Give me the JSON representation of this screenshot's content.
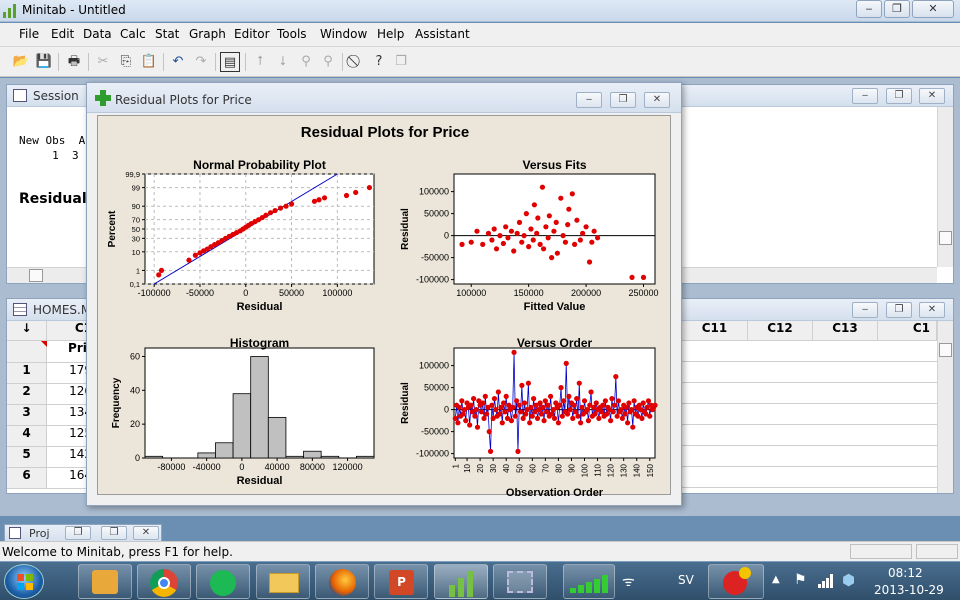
{
  "app": {
    "title": "Minitab - Untitled",
    "window_controls": {
      "minimize": "‒",
      "restore": "❐",
      "close": "✕"
    }
  },
  "menu": [
    "File",
    "Edit",
    "Data",
    "Calc",
    "Stat",
    "Graph",
    "Editor",
    "Tools",
    "Window",
    "Help",
    "Assistant"
  ],
  "session": {
    "title": "Session",
    "line1": "New Obs  A",
    "line2": "     1  3",
    "heading": "Residual P"
  },
  "worksheet": {
    "title": "HOMES.M",
    "corner": "↓",
    "col_c1": "C1",
    "col_c1_name": "Pric",
    "right_cols": [
      "C11",
      "C12",
      "C13",
      "C1"
    ],
    "rows": [
      {
        "n": "1",
        "v": "179"
      },
      {
        "n": "2",
        "v": "126"
      },
      {
        "n": "3",
        "v": "134"
      },
      {
        "n": "4",
        "v": "125"
      },
      {
        "n": "5",
        "v": "142"
      },
      {
        "n": "6",
        "v": "164"
      }
    ]
  },
  "graph_window": {
    "title": "Residual Plots for Price",
    "main_title": "Residual Plots for Price"
  },
  "chart_data": [
    {
      "type": "scatter",
      "title": "Normal Probability Plot",
      "xlabel": "Residual",
      "ylabel": "Percent",
      "xticks": [
        "-100000",
        "-50000",
        "0",
        "50000",
        "100000"
      ],
      "yticks": [
        "0,1",
        "1",
        "10",
        "30",
        "50",
        "70",
        "90",
        "99",
        "99,9"
      ],
      "x_ticks_values": [
        -100000,
        -50000,
        0,
        50000,
        100000
      ],
      "y_ticks_values": [
        0.1,
        1,
        10,
        30,
        50,
        70,
        90,
        99,
        99.9
      ],
      "xlim": [
        -110000,
        140000
      ],
      "ylim": [
        0.1,
        99.9
      ],
      "grid": true,
      "fit_line": [
        [
          -100000,
          0.05
        ],
        [
          100000,
          99.95
        ]
      ],
      "points": [
        [
          -95000,
          0.5
        ],
        [
          -92000,
          1
        ],
        [
          -62000,
          4
        ],
        [
          -55000,
          7
        ],
        [
          -50000,
          9
        ],
        [
          -46000,
          11
        ],
        [
          -42000,
          13
        ],
        [
          -38000,
          16
        ],
        [
          -34000,
          19
        ],
        [
          -30000,
          22
        ],
        [
          -26000,
          26
        ],
        [
          -22000,
          30
        ],
        [
          -18000,
          34
        ],
        [
          -14000,
          38
        ],
        [
          -10000,
          42
        ],
        [
          -6000,
          46
        ],
        [
          -3000,
          50
        ],
        [
          0,
          54
        ],
        [
          3000,
          58
        ],
        [
          6000,
          62
        ],
        [
          10000,
          66
        ],
        [
          14000,
          70
        ],
        [
          18000,
          74
        ],
        [
          22000,
          78
        ],
        [
          27000,
          82
        ],
        [
          32000,
          85
        ],
        [
          38000,
          88
        ],
        [
          44000,
          90
        ],
        [
          50000,
          92
        ],
        [
          75000,
          94
        ],
        [
          80000,
          95
        ],
        [
          86000,
          96
        ],
        [
          110000,
          97
        ],
        [
          120000,
          98
        ],
        [
          135000,
          99
        ]
      ]
    },
    {
      "type": "scatter",
      "title": "Versus Fits",
      "xlabel": "Fitted Value",
      "ylabel": "Residual",
      "xticks": [
        "100000",
        "150000",
        "200000",
        "250000"
      ],
      "yticks": [
        "-100000",
        "-50000",
        "0",
        "50000",
        "100000"
      ],
      "x_ticks_values": [
        100000,
        150000,
        200000,
        250000
      ],
      "y_ticks_values": [
        -100000,
        -50000,
        0,
        50000,
        100000
      ],
      "xlim": [
        85000,
        260000
      ],
      "ylim": [
        -110000,
        140000
      ],
      "hline": 0,
      "points": [
        [
          92000,
          -20000
        ],
        [
          100000,
          -15000
        ],
        [
          105000,
          10000
        ],
        [
          110000,
          -20000
        ],
        [
          115000,
          5000
        ],
        [
          118000,
          -10000
        ],
        [
          120000,
          15000
        ],
        [
          122000,
          -30000
        ],
        [
          125000,
          0
        ],
        [
          128000,
          -18000
        ],
        [
          130000,
          20000
        ],
        [
          132000,
          -5000
        ],
        [
          135000,
          10000
        ],
        [
          137000,
          -35000
        ],
        [
          140000,
          5000
        ],
        [
          142000,
          30000
        ],
        [
          144000,
          -15000
        ],
        [
          146000,
          0
        ],
        [
          148000,
          50000
        ],
        [
          150000,
          -25000
        ],
        [
          152000,
          15000
        ],
        [
          154000,
          -10000
        ],
        [
          155000,
          70000
        ],
        [
          157000,
          5000
        ],
        [
          158000,
          40000
        ],
        [
          160000,
          -20000
        ],
        [
          162000,
          110000
        ],
        [
          163000,
          -30000
        ],
        [
          165000,
          20000
        ],
        [
          167000,
          -5000
        ],
        [
          168000,
          45000
        ],
        [
          170000,
          -50000
        ],
        [
          172000,
          10000
        ],
        [
          174000,
          30000
        ],
        [
          175000,
          -40000
        ],
        [
          178000,
          85000
        ],
        [
          180000,
          0
        ],
        [
          182000,
          -15000
        ],
        [
          184000,
          25000
        ],
        [
          185000,
          60000
        ],
        [
          188000,
          95000
        ],
        [
          190000,
          -20000
        ],
        [
          192000,
          35000
        ],
        [
          195000,
          -10000
        ],
        [
          197000,
          5000
        ],
        [
          200000,
          20000
        ],
        [
          203000,
          -60000
        ],
        [
          205000,
          -15000
        ],
        [
          207000,
          10000
        ],
        [
          210000,
          -5000
        ],
        [
          240000,
          -95000
        ],
        [
          250000,
          -95000
        ]
      ]
    },
    {
      "type": "bar",
      "title": "Histogram",
      "xlabel": "Residual",
      "ylabel": "Frequency",
      "xticks": [
        "-80000",
        "-40000",
        "0",
        "40000",
        "80000",
        "120000"
      ],
      "yticks": [
        "0",
        "20",
        "40",
        "60"
      ],
      "x_ticks_values": [
        -80000,
        -40000,
        0,
        40000,
        80000,
        120000
      ],
      "y_ticks_values": [
        0,
        20,
        40,
        60
      ],
      "xlim": [
        -110000,
        150000
      ],
      "ylim": [
        0,
        65
      ],
      "bin_width": 20000,
      "bins": [
        -100000,
        -80000,
        -60000,
        -40000,
        -20000,
        0,
        20000,
        40000,
        60000,
        80000,
        100000,
        120000,
        140000
      ],
      "values": [
        1,
        0,
        0,
        3,
        9,
        38,
        60,
        24,
        1,
        4,
        1,
        0,
        1
      ]
    },
    {
      "type": "line",
      "title": "Versus Order",
      "xlabel": "Observation Order",
      "ylabel": "Residual",
      "xticks": [
        "1",
        "10",
        "20",
        "30",
        "40",
        "50",
        "60",
        "70",
        "80",
        "90",
        "100",
        "110",
        "120",
        "130",
        "140",
        "150"
      ],
      "yticks": [
        "-100000",
        "-50000",
        "0",
        "50000",
        "100000"
      ],
      "x_ticks_values": [
        1,
        10,
        20,
        30,
        40,
        50,
        60,
        70,
        80,
        90,
        100,
        110,
        120,
        130,
        140,
        150
      ],
      "y_ticks_values": [
        -100000,
        -50000,
        0,
        50000,
        100000
      ],
      "xlim": [
        0,
        154
      ],
      "ylim": [
        -110000,
        140000
      ],
      "hline": 0,
      "values": [
        -20000,
        10000,
        -30000,
        5000,
        -15000,
        20000,
        -10000,
        0,
        -25000,
        15000,
        5000,
        -35000,
        10000,
        -5000,
        25000,
        -15000,
        0,
        -40000,
        20000,
        10000,
        -5000,
        15000,
        -20000,
        30000,
        -10000,
        5000,
        -50000,
        -95000,
        10000,
        -20000,
        25000,
        0,
        -15000,
        40000,
        -10000,
        5000,
        -30000,
        15000,
        -5000,
        30000,
        -20000,
        10000,
        0,
        -25000,
        5000,
        130000,
        -15000,
        20000,
        -95000,
        10000,
        -5000,
        55000,
        -20000,
        15000,
        -10000,
        0,
        60000,
        -30000,
        5000,
        -15000,
        25000,
        -5000,
        10000,
        -20000,
        0,
        15000,
        -10000,
        5000,
        -25000,
        20000,
        -5000,
        10000,
        -15000,
        30000,
        -10000,
        0,
        -20000,
        15000,
        5000,
        -30000,
        10000,
        50000,
        -15000,
        20000,
        -5000,
        105000,
        -10000,
        30000,
        0,
        15000,
        -20000,
        10000,
        -5000,
        25000,
        -15000,
        60000,
        -30000,
        5000,
        -10000,
        20000,
        -5000,
        0,
        -25000,
        10000,
        40000,
        -15000,
        5000,
        -10000,
        15000,
        0,
        -20000,
        5000,
        -5000,
        10000,
        -15000,
        20000,
        -10000,
        5000,
        0,
        -25000,
        25000,
        -5000,
        10000,
        75000,
        -15000,
        20000,
        -5000,
        0,
        -20000,
        10000,
        -10000,
        5000,
        -30000,
        15000,
        -5000,
        0,
        -40000,
        20000,
        -10000,
        5000,
        -15000,
        10000,
        0,
        -20000,
        15000,
        -5000,
        -10000,
        5000,
        20000,
        -15000,
        10000,
        0,
        5000,
        10000
      ]
    }
  ],
  "statusbar": {
    "text": "Welcome to Minitab, press F1 for help."
  },
  "taskbar": {
    "lang": "SV",
    "time": "08:12",
    "date": "2013-10-29"
  },
  "proj": {
    "title": "Proj"
  },
  "colors": {
    "accent": "#1a4f9c",
    "marker": "#e00000",
    "line": "#0000c8",
    "bar": "#c0c0c0"
  }
}
